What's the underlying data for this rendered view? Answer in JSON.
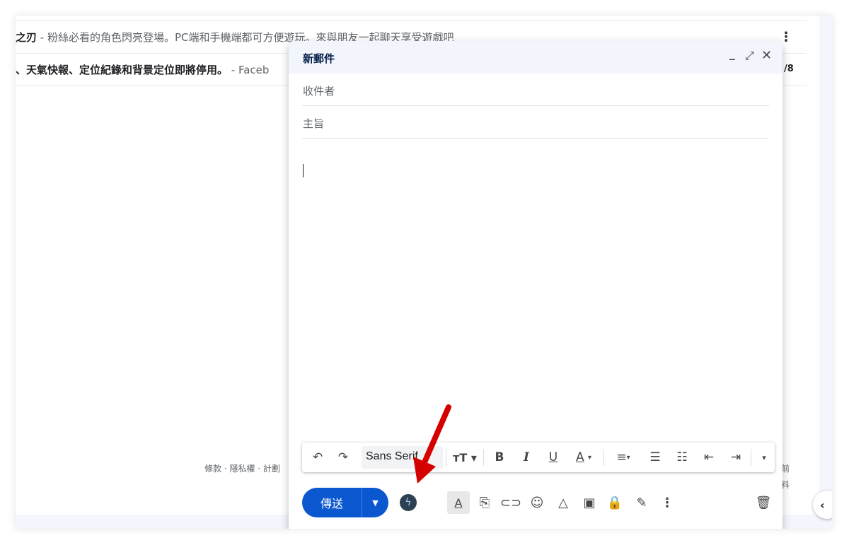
{
  "inbox": {
    "rows": [
      {
        "title": "之刃",
        "sep": " - ",
        "snippet": "粉絲必看的角色閃亮登場。PC端和手機端都可方便遊玩。來與朋友一起聊天享受遊戲吧"
      },
      {
        "title": "、天氣快報、定位紀錄和背景定位即將停用。",
        "sep": " - ",
        "snippet": "Faceb"
      }
    ],
    "row2_date": "/8",
    "footer_links": "條款 · 隱私權 · 計劃",
    "footer_right_1": "前",
    "footer_right_2": "料"
  },
  "compose": {
    "title": "新郵件",
    "to_label": "收件者",
    "subject_label": "主旨",
    "font_name": "Sans Serif",
    "send_label": "傳送"
  },
  "colors": {
    "send_button": "#0b57d0",
    "header_bg": "#f2f6fc",
    "annotation_arrow": "#d50000"
  },
  "icons": [
    "undo-icon",
    "redo-icon",
    "font-size-icon",
    "bold-icon",
    "italic-icon",
    "underline-icon",
    "text-color-icon",
    "align-icon",
    "numbered-list-icon",
    "bulleted-list-icon",
    "indent-less-icon",
    "indent-more-icon",
    "more-formatting-icon",
    "ai-assist-bolt-icon",
    "formatting-options-icon",
    "attach-icon",
    "link-icon",
    "emoji-icon",
    "drive-icon",
    "photo-icon",
    "confidential-mode-icon",
    "signature-icon",
    "more-options-icon",
    "trash-icon"
  ]
}
